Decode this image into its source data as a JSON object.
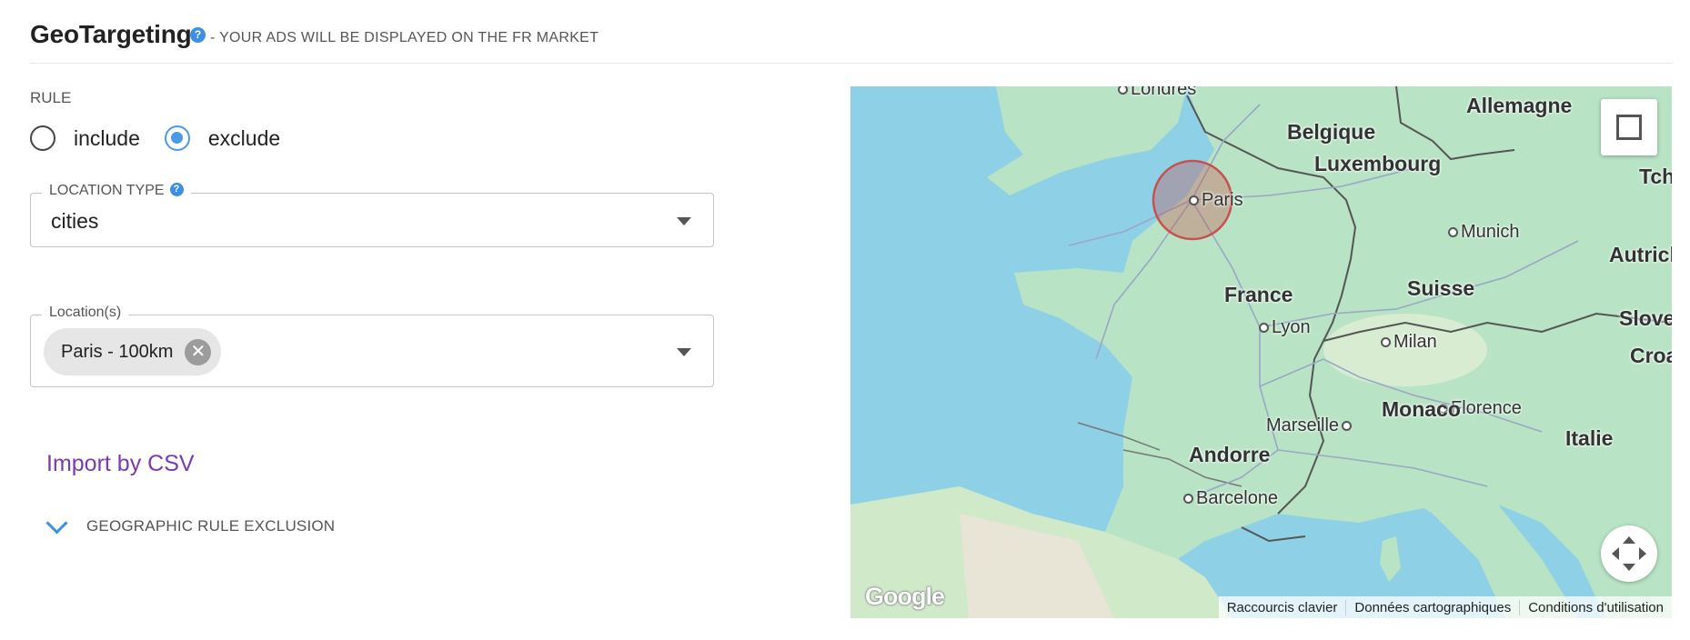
{
  "header": {
    "title": "GeoTargeting",
    "help_icon": "?",
    "subtitle": "- YOUR ADS WILL BE DISPLAYED ON THE FR MARKET"
  },
  "rule": {
    "label": "RULE",
    "options": [
      {
        "label": "include",
        "checked": false
      },
      {
        "label": "exclude",
        "checked": true
      }
    ]
  },
  "location_type": {
    "legend": "LOCATION TYPE",
    "help_icon": "?",
    "value": "cities"
  },
  "locations": {
    "legend": "Location(s)",
    "chips": [
      {
        "label": "Paris - 100km",
        "remove_icon": "✕"
      }
    ]
  },
  "import_csv": {
    "label": "Import by CSV"
  },
  "exclusion_toggle": {
    "label": "GEOGRAPHIC RULE EXCLUSION"
  },
  "map": {
    "countries": [
      "Allemagne",
      "Belgique",
      "Luxembourg",
      "France",
      "Suisse",
      "Monaco",
      "Italie",
      "Andorre",
      "Tch",
      "Autrich",
      "Slove",
      "Croa"
    ],
    "cities": [
      "Londres",
      "Paris",
      "Munich",
      "Lyon",
      "Milan",
      "Florence",
      "Marseille",
      "Barcelone"
    ],
    "logo": "Google",
    "attribution": [
      "Raccourcis clavier",
      "Données cartographiques",
      "Conditions d'utilisation"
    ],
    "colors": {
      "water": "#8ed0e6",
      "land": "#b8e3c4",
      "radius": "#c8504f",
      "accent": "#4a9ae8"
    }
  }
}
